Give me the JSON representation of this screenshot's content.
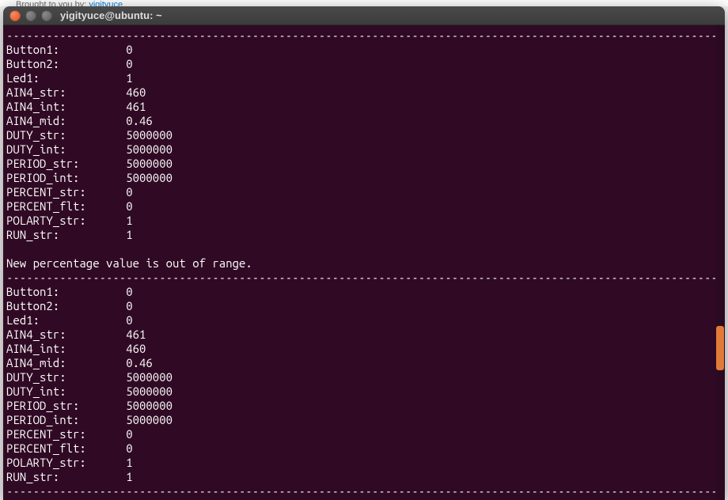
{
  "page_header_prefix": "Brought to you by:",
  "page_header_link": "yigityuce",
  "window_title": "yigityuce@ubuntu: ~",
  "separator": "-----------------------------------------------------------------------------------------------------------------",
  "message": "New percentage value is out of range.",
  "blocks": [
    {
      "rows": [
        {
          "label": "Button1:",
          "value": "0"
        },
        {
          "label": "Button2:",
          "value": "0"
        },
        {
          "label": "Led1:",
          "value": "1"
        },
        {
          "label": "AIN4_str:",
          "value": "460"
        },
        {
          "label": "AIN4_int:",
          "value": "461"
        },
        {
          "label": "AIN4_mid:",
          "value": "0.46"
        },
        {
          "label": "DUTY_str:",
          "value": "5000000"
        },
        {
          "label": "DUTY_int:",
          "value": "5000000"
        },
        {
          "label": "PERIOD_str:",
          "value": "5000000"
        },
        {
          "label": "PERIOD_int:",
          "value": "5000000"
        },
        {
          "label": "PERCENT_str:",
          "value": "0"
        },
        {
          "label": "PERCENT_flt:",
          "value": "0"
        },
        {
          "label": "POLARTY_str:",
          "value": "1"
        },
        {
          "label": "RUN_str:",
          "value": "1"
        }
      ]
    },
    {
      "rows": [
        {
          "label": "Button1:",
          "value": "0"
        },
        {
          "label": "Button2:",
          "value": "0"
        },
        {
          "label": "Led1:",
          "value": "0"
        },
        {
          "label": "AIN4_str:",
          "value": "461"
        },
        {
          "label": "AIN4_int:",
          "value": "460"
        },
        {
          "label": "AIN4_mid:",
          "value": "0.46"
        },
        {
          "label": "DUTY_str:",
          "value": "5000000"
        },
        {
          "label": "DUTY_int:",
          "value": "5000000"
        },
        {
          "label": "PERIOD_str:",
          "value": "5000000"
        },
        {
          "label": "PERIOD_int:",
          "value": "5000000"
        },
        {
          "label": "PERCENT_str:",
          "value": "0"
        },
        {
          "label": "PERCENT_flt:",
          "value": "0"
        },
        {
          "label": "POLARTY_str:",
          "value": "1"
        },
        {
          "label": "RUN_str:",
          "value": "1"
        }
      ]
    }
  ]
}
